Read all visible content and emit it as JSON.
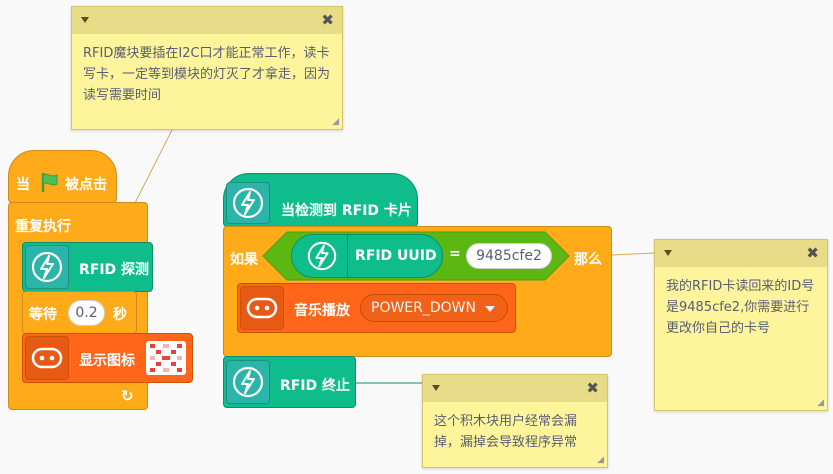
{
  "notes": {
    "top": {
      "text": "RFID魔块要插在I2C口才能正常工作，读卡写卡，一定等到模块的灯灭了才拿走，因为读写需要时间"
    },
    "right": {
      "text": "我的RFID卡读回来的ID号是9485cfe2,你需要进行更改你自己的卡号"
    },
    "bottom": {
      "text": "这个积木块用户经常会漏掉，漏掉会导致程序异常"
    }
  },
  "script1": {
    "hat_when": "当",
    "hat_clicked": "被点击",
    "repeat": "重复执行",
    "rfid_detect": "RFID 探测",
    "wait_label": "等待",
    "wait_value": "0.2",
    "wait_unit": "秒",
    "show_icon": "显示图标"
  },
  "script2": {
    "hat_label": "当检测到 RFID 卡片",
    "if_label": "如果",
    "uuid_label": "RFID UUID",
    "equals": "=",
    "card_value": "9485cfe2",
    "then_label": "那么",
    "play_label": "音乐播放",
    "sound_value": "POWER_DOWN",
    "stop_label": "RFID 终止"
  },
  "colors": {
    "control": "#ffab19",
    "extension": "#0fbd8c",
    "output": "#ff6619",
    "operator": "#5cb712",
    "note": "#fef49c"
  },
  "icons": [
    "flag-icon",
    "lightning-icon",
    "matrix-icon",
    "note-collapse-icon",
    "note-close-icon",
    "loop-arrow-icon",
    "dropdown-arrow-icon"
  ]
}
